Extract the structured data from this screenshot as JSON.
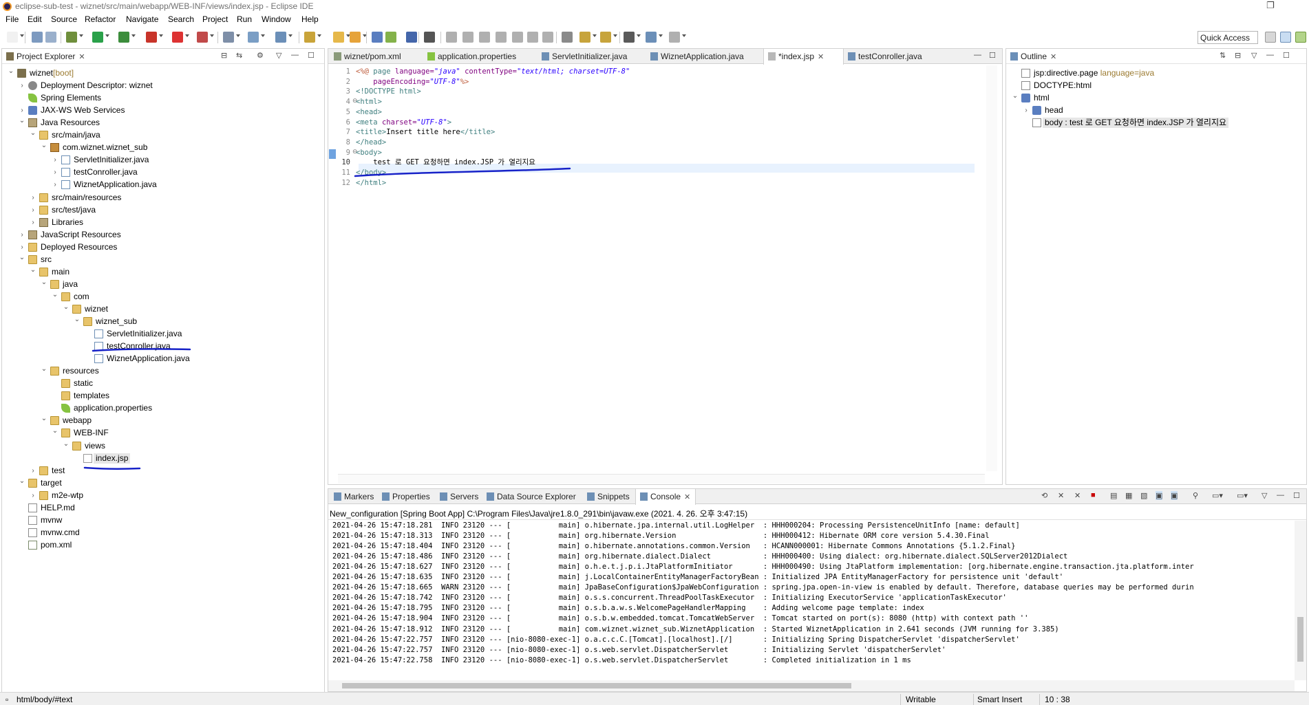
{
  "window": {
    "title": "eclipse-sub-test - wiznet/src/main/webapp/WEB-INF/views/index.jsp - Eclipse IDE"
  },
  "menu": [
    "File",
    "Edit",
    "Source",
    "Refactor",
    "Navigate",
    "Search",
    "Project",
    "Run",
    "Window",
    "Help"
  ],
  "toolbar": {
    "quick_access": "Quick Access"
  },
  "project_explorer": {
    "tab_label": "Project Explorer",
    "tree": [
      {
        "label": "wiznet",
        "suffix": "[boot]",
        "icon": "project-icon",
        "level": 0,
        "expanded": true
      },
      {
        "label": "Deployment Descriptor: wiznet",
        "icon": "descriptor-icon",
        "level": 1,
        "expanded": false
      },
      {
        "label": "Spring Elements",
        "icon": "spring-icon",
        "level": 1,
        "expanded": null
      },
      {
        "label": "JAX-WS Web Services",
        "icon": "web-services-icon",
        "level": 1,
        "expanded": false
      },
      {
        "label": "Java Resources",
        "icon": "java-resources-icon",
        "level": 1,
        "expanded": true
      },
      {
        "label": "src/main/java",
        "icon": "source-folder-icon",
        "level": 2,
        "expanded": true
      },
      {
        "label": "com.wiznet.wiznet_sub",
        "icon": "package-icon",
        "level": 3,
        "expanded": true
      },
      {
        "label": "ServletInitializer.java",
        "icon": "java-file-icon",
        "level": 4,
        "expanded": false
      },
      {
        "label": "testConroller.java",
        "icon": "java-file-icon",
        "level": 4,
        "expanded": false
      },
      {
        "label": "WiznetApplication.java",
        "icon": "java-file-icon",
        "level": 4,
        "expanded": false
      },
      {
        "label": "src/main/resources",
        "icon": "source-folder-icon",
        "level": 2,
        "expanded": false
      },
      {
        "label": "src/test/java",
        "icon": "source-folder-icon",
        "level": 2,
        "expanded": false
      },
      {
        "label": "Libraries",
        "icon": "library-icon",
        "level": 2,
        "expanded": false
      },
      {
        "label": "JavaScript Resources",
        "icon": "js-resources-icon",
        "level": 1,
        "expanded": false
      },
      {
        "label": "Deployed Resources",
        "icon": "deployed-resources-icon",
        "level": 1,
        "expanded": false
      },
      {
        "label": "src",
        "icon": "folder-icon",
        "level": 1,
        "expanded": true
      },
      {
        "label": "main",
        "icon": "folder-icon",
        "level": 2,
        "expanded": true
      },
      {
        "label": "java",
        "icon": "folder-icon",
        "level": 3,
        "expanded": true
      },
      {
        "label": "com",
        "icon": "folder-icon",
        "level": 4,
        "expanded": true
      },
      {
        "label": "wiznet",
        "icon": "folder-icon",
        "level": 5,
        "expanded": true
      },
      {
        "label": "wiznet_sub",
        "icon": "folder-icon",
        "level": 6,
        "expanded": true
      },
      {
        "label": "ServletInitializer.java",
        "icon": "java-file-icon",
        "level": 7,
        "expanded": null
      },
      {
        "label": "testConroller.java",
        "icon": "java-file-icon",
        "level": 7,
        "expanded": null,
        "underlined": true
      },
      {
        "label": "WiznetApplication.java",
        "icon": "java-file-icon",
        "level": 7,
        "expanded": null
      },
      {
        "label": "resources",
        "icon": "folder-icon",
        "level": 3,
        "expanded": true
      },
      {
        "label": "static",
        "icon": "folder-icon",
        "level": 4,
        "expanded": null
      },
      {
        "label": "templates",
        "icon": "folder-icon",
        "level": 4,
        "expanded": null
      },
      {
        "label": "application.properties",
        "icon": "properties-icon",
        "level": 4,
        "expanded": null
      },
      {
        "label": "webapp",
        "icon": "folder-icon",
        "level": 3,
        "expanded": true
      },
      {
        "label": "WEB-INF",
        "icon": "folder-icon",
        "level": 4,
        "expanded": true
      },
      {
        "label": "views",
        "icon": "folder-icon",
        "level": 5,
        "expanded": true
      },
      {
        "label": "index.jsp",
        "icon": "jsp-file-icon",
        "level": 6,
        "expanded": null,
        "selected": true,
        "underlined": true
      },
      {
        "label": "test",
        "icon": "folder-icon",
        "level": 2,
        "expanded": false
      },
      {
        "label": "target",
        "icon": "folder-icon",
        "level": 1,
        "expanded": true
      },
      {
        "label": "m2e-wtp",
        "icon": "folder-icon",
        "level": 2,
        "expanded": false
      },
      {
        "label": "HELP.md",
        "icon": "file-icon",
        "level": 1,
        "expanded": null
      },
      {
        "label": "mvnw",
        "icon": "file-icon",
        "level": 1,
        "expanded": null
      },
      {
        "label": "mvnw.cmd",
        "icon": "file-icon",
        "level": 1,
        "expanded": null
      },
      {
        "label": "pom.xml",
        "icon": "xml-file-icon",
        "level": 1,
        "expanded": null
      }
    ]
  },
  "editor": {
    "tabs": [
      {
        "label": "wiznet/pom.xml",
        "icon": "xml-file-icon",
        "active": false
      },
      {
        "label": "application.properties",
        "icon": "properties-icon",
        "active": false
      },
      {
        "label": "ServletInitializer.java",
        "icon": "java-file-icon",
        "active": false
      },
      {
        "label": "WiznetApplication.java",
        "icon": "java-file-icon",
        "active": false
      },
      {
        "label": "*index.jsp",
        "icon": "jsp-file-icon",
        "active": true
      },
      {
        "label": "testConroller.java",
        "icon": "java-file-icon",
        "active": false
      }
    ],
    "lines": [
      {
        "n": "1",
        "parts": [
          [
            "dir",
            "<%@ "
          ],
          [
            "tag",
            "page "
          ],
          [
            "attr",
            "language="
          ],
          [
            "str",
            "\"java\""
          ],
          [
            "attr",
            " contentType="
          ],
          [
            "str",
            "\"text/html; charset=UTF-8\""
          ]
        ]
      },
      {
        "n": "2",
        "parts": [
          [
            "attr",
            "    pageEncoding="
          ],
          [
            "str",
            "\"UTF-8\""
          ],
          [
            "dir",
            "%>"
          ]
        ]
      },
      {
        "n": "3",
        "parts": [
          [
            "tag",
            "<!DOCTYPE html>"
          ]
        ]
      },
      {
        "n": "4",
        "fold": true,
        "parts": [
          [
            "tag",
            "<html>"
          ]
        ]
      },
      {
        "n": "5",
        "parts": [
          [
            "tag",
            "<head>"
          ]
        ]
      },
      {
        "n": "6",
        "parts": [
          [
            "tag",
            "<meta "
          ],
          [
            "attr",
            "charset="
          ],
          [
            "str",
            "\"UTF-8\""
          ],
          [
            "tag",
            ">"
          ]
        ]
      },
      {
        "n": "7",
        "parts": [
          [
            "tag",
            "<title>"
          ],
          [
            "txt",
            "Insert title here"
          ],
          [
            "tag",
            "</title>"
          ]
        ]
      },
      {
        "n": "8",
        "parts": [
          [
            "tag",
            "</head>"
          ]
        ]
      },
      {
        "n": "9",
        "fold": true,
        "parts": [
          [
            "tag",
            "<body>"
          ]
        ]
      },
      {
        "n": "10",
        "current": true,
        "parts": [
          [
            "txt",
            "    test 로 GET 요청하면 index.JSP 가 열리지요"
          ]
        ]
      },
      {
        "n": "11",
        "parts": [
          [
            "tag",
            "</body>"
          ]
        ]
      },
      {
        "n": "12",
        "parts": [
          [
            "tag",
            "</html>"
          ]
        ]
      }
    ]
  },
  "outline": {
    "tab_label": "Outline",
    "items": [
      {
        "label": "jsp:directive.page",
        "suffix": " language=java",
        "icon": "directive-icon",
        "level": 0,
        "expanded": null
      },
      {
        "label": "DOCTYPE:html",
        "icon": "doctype-icon",
        "level": 0,
        "expanded": null
      },
      {
        "label": "html",
        "icon": "element-icon",
        "level": 0,
        "expanded": true
      },
      {
        "label": "head",
        "icon": "element-icon",
        "level": 1,
        "expanded": false
      },
      {
        "label": "body : test 로 GET 요청하면 index.JSP 가 열리지요",
        "icon": "text-node-icon",
        "level": 1,
        "expanded": null,
        "selected": true
      }
    ]
  },
  "bottom": {
    "tabs": [
      {
        "label": "Markers",
        "icon": "markers-icon",
        "active": false
      },
      {
        "label": "Properties",
        "icon": "properties-view-icon",
        "active": false
      },
      {
        "label": "Servers",
        "icon": "servers-icon",
        "active": false
      },
      {
        "label": "Data Source Explorer",
        "icon": "datasource-icon",
        "active": false
      },
      {
        "label": "Snippets",
        "icon": "snippets-icon",
        "active": false
      },
      {
        "label": "Console",
        "icon": "console-icon",
        "active": true
      }
    ],
    "console_header": "New_configuration [Spring Boot App] C:\\Program Files\\Java\\jre1.8.0_291\\bin\\javaw.exe (2021. 4. 26. 오후 3:47:15)",
    "console_lines": [
      "2021-04-26 15:47:18.281  INFO 23120 --- [           main] o.hibernate.jpa.internal.util.LogHelper  : HHH000204: Processing PersistenceUnitInfo [name: default]",
      "2021-04-26 15:47:18.313  INFO 23120 --- [           main] org.hibernate.Version                    : HHH000412: Hibernate ORM core version 5.4.30.Final",
      "2021-04-26 15:47:18.404  INFO 23120 --- [           main] o.hibernate.annotations.common.Version   : HCANN000001: Hibernate Commons Annotations {5.1.2.Final}",
      "2021-04-26 15:47:18.486  INFO 23120 --- [           main] org.hibernate.dialect.Dialect            : HHH000400: Using dialect: org.hibernate.dialect.SQLServer2012Dialect",
      "2021-04-26 15:47:18.627  INFO 23120 --- [           main] o.h.e.t.j.p.i.JtaPlatformInitiator       : HHH000490: Using JtaPlatform implementation: [org.hibernate.engine.transaction.jta.platform.inter",
      "2021-04-26 15:47:18.635  INFO 23120 --- [           main] j.LocalContainerEntityManagerFactoryBean : Initialized JPA EntityManagerFactory for persistence unit 'default'",
      "2021-04-26 15:47:18.665  WARN 23120 --- [           main] JpaBaseConfiguration$JpaWebConfiguration : spring.jpa.open-in-view is enabled by default. Therefore, database queries may be performed durin",
      "2021-04-26 15:47:18.742  INFO 23120 --- [           main] o.s.s.concurrent.ThreadPoolTaskExecutor  : Initializing ExecutorService 'applicationTaskExecutor'",
      "2021-04-26 15:47:18.795  INFO 23120 --- [           main] o.s.b.a.w.s.WelcomePageHandlerMapping    : Adding welcome page template: index",
      "2021-04-26 15:47:18.904  INFO 23120 --- [           main] o.s.b.w.embedded.tomcat.TomcatWebServer  : Tomcat started on port(s): 8080 (http) with context path ''",
      "2021-04-26 15:47:18.912  INFO 23120 --- [           main] com.wiznet.wiznet_sub.WiznetApplication  : Started WiznetApplication in 2.641 seconds (JVM running for 3.385)",
      "2021-04-26 15:47:22.757  INFO 23120 --- [nio-8080-exec-1] o.a.c.c.C.[Tomcat].[localhost].[/]       : Initializing Spring DispatcherServlet 'dispatcherServlet'",
      "2021-04-26 15:47:22.757  INFO 23120 --- [nio-8080-exec-1] o.s.web.servlet.DispatcherServlet        : Initializing Servlet 'dispatcherServlet'",
      "2021-04-26 15:47:22.758  INFO 23120 --- [nio-8080-exec-1] o.s.web.servlet.DispatcherServlet        : Completed initialization in 1 ms"
    ]
  },
  "status_bar": {
    "path": "html/body/#text",
    "writable": "Writable",
    "insert_mode": "Smart Insert",
    "position": "10 : 38"
  },
  "colors": {
    "annotation_underline": "#1722c8",
    "selection": "#e6e6e6",
    "current_line": "#e8f2fe"
  }
}
